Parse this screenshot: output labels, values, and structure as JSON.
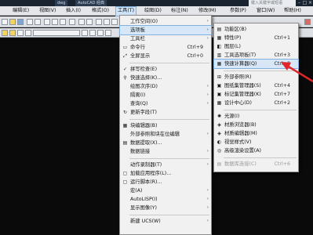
{
  "title_bar": {
    "tab_fragment_1": "dwg",
    "tab_fragment_2": "AutoCAD 经典",
    "search_placeholder": "键入关键字或短语",
    "minimize": "–",
    "maximize": "□",
    "close": "×"
  },
  "menubar": [
    {
      "label": "编辑(E)"
    },
    {
      "label": "视图(V)"
    },
    {
      "label": "插入(I)"
    },
    {
      "label": "格式(O)"
    },
    {
      "label": "工具(T)"
    },
    {
      "label": "绘图(D)"
    },
    {
      "label": "标注(N)"
    },
    {
      "label": "修改(M)"
    },
    {
      "label": "参数(P)"
    },
    {
      "label": "窗口(W)"
    },
    {
      "label": "帮助(H)"
    }
  ],
  "tools_menu": {
    "items": [
      {
        "label": "工作空间(O)",
        "arrow": "›"
      },
      {
        "label": "选项板",
        "arrow": "›"
      },
      {
        "label": "工具栏",
        "arrow": "›"
      },
      {
        "label": "命令行",
        "shortcut": "Ctrl+9",
        "icon": "▭"
      },
      {
        "label": "全屏显示",
        "shortcut": "Ctrl+0",
        "icon": "⤢"
      },
      {
        "label": "拼写检查(E)",
        "icon": "✓"
      },
      {
        "label": "快速选择(K)...",
        "icon": "⚲"
      },
      {
        "label": "绘图次序(D)",
        "arrow": "›"
      },
      {
        "label": "隔离(I)",
        "arrow": "›"
      },
      {
        "label": "查询(Q)",
        "arrow": "›"
      },
      {
        "label": "更新字段(T)",
        "icon": "↻"
      },
      {
        "label": "块编辑器(B)",
        "icon": "▦"
      },
      {
        "label": "外部参照和块在位编辑",
        "arrow": "›"
      },
      {
        "label": "数据提取(X)...",
        "icon": "▤"
      },
      {
        "label": "数据链接",
        "arrow": "›"
      },
      {
        "label": "动作录制器(T)",
        "arrow": "›"
      },
      {
        "label": "加载应用程序(L)...",
        "icon": "▢"
      },
      {
        "label": "运行脚本(R)...",
        "icon": "▢"
      },
      {
        "label": "宏(A)",
        "arrow": "›"
      },
      {
        "label": "AutoLISP(I)",
        "arrow": "›"
      },
      {
        "label": "显示图像(Y)",
        "arrow": "›"
      },
      {
        "label": "新建 UCS(W)",
        "arrow": "›"
      }
    ]
  },
  "palettes_submenu": {
    "items": [
      {
        "label": "功能区(B)",
        "icon": "▤"
      },
      {
        "label": "特性(P)",
        "shortcut": "Ctrl+1",
        "icon": "▦"
      },
      {
        "label": "图层(L)",
        "icon": "◧"
      },
      {
        "label": "工具选项板(T)",
        "shortcut": "Ctrl+3",
        "icon": "▥"
      },
      {
        "label": "快速计算器(Q)",
        "shortcut": "Ctrl+8",
        "icon": "▦"
      },
      {
        "label": "外部参照(R)",
        "icon": "⊞"
      },
      {
        "label": "图纸集管理器(S)",
        "shortcut": "Ctrl+4",
        "icon": "▣"
      },
      {
        "label": "标记集管理器(K)",
        "shortcut": "Ctrl+7",
        "icon": "▣"
      },
      {
        "label": "设计中心(D)",
        "shortcut": "Ctrl+2",
        "icon": "▦"
      },
      {
        "label": "光源(I)",
        "icon": "✺"
      },
      {
        "label": "材质浏览器(B)",
        "icon": "◈"
      },
      {
        "label": "材质编辑器(M)",
        "icon": "◈"
      },
      {
        "label": "视觉样式(V)",
        "icon": "◐"
      },
      {
        "label": "高级渲染设置(A)",
        "icon": "◎"
      },
      {
        "label": "数据库连接(C)",
        "shortcut": "Ctrl+6",
        "icon": "▤"
      }
    ]
  },
  "colors": {
    "highlight": "#d7e7f7",
    "highlight_border": "#7fb1e0",
    "menu_bg": "#f1f1f1",
    "arrow": "#e0262a"
  }
}
